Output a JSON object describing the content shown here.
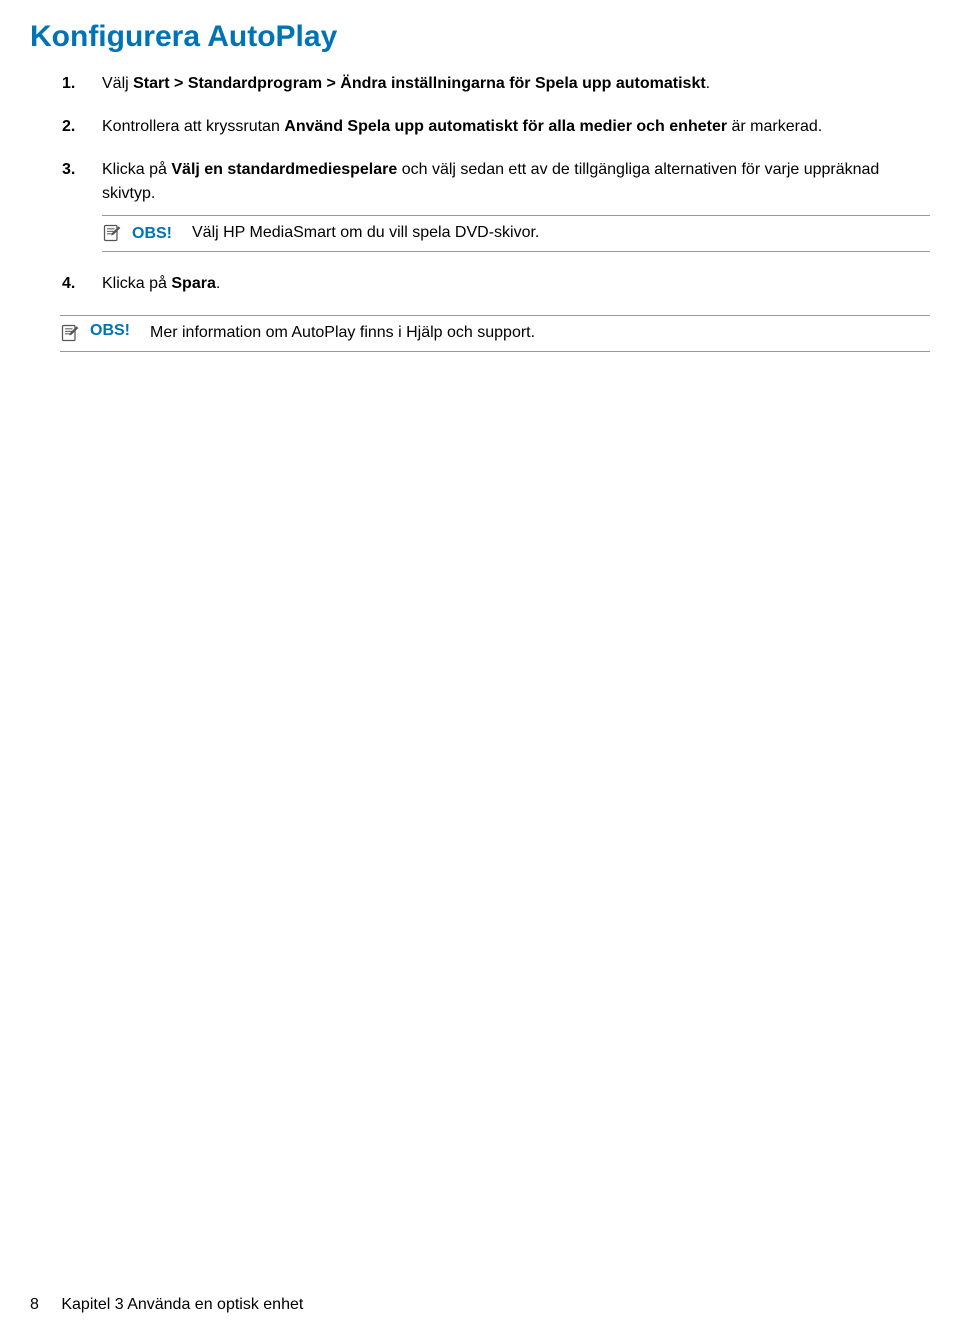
{
  "title": "Konfigurera AutoPlay",
  "steps": {
    "s1": {
      "num": "1.",
      "pre": "Välj ",
      "bold": "Start > Standardprogram > Ändra inställningarna för Spela upp automatiskt",
      "post": "."
    },
    "s2": {
      "num": "2.",
      "pre": "Kontrollera att kryssrutan ",
      "bold": "Använd Spela upp automatiskt för alla medier och enheter",
      "post": " är markerad."
    },
    "s3": {
      "num": "3.",
      "pre": "Klicka på ",
      "bold": "Välj en standardmediespelare",
      "post": " och välj sedan ett av de tillgängliga alternativen för varje uppräknad skivtyp."
    },
    "s4": {
      "num": "4.",
      "pre": "Klicka på ",
      "bold": "Spara",
      "post": "."
    }
  },
  "notes": {
    "label": "OBS!",
    "inner": "Välj HP MediaSmart om du vill spela DVD-skivor.",
    "outer": "Mer information om AutoPlay finns i Hjälp och support."
  },
  "footer": {
    "page": "8",
    "chapter": "Kapitel 3   Använda en optisk enhet"
  }
}
